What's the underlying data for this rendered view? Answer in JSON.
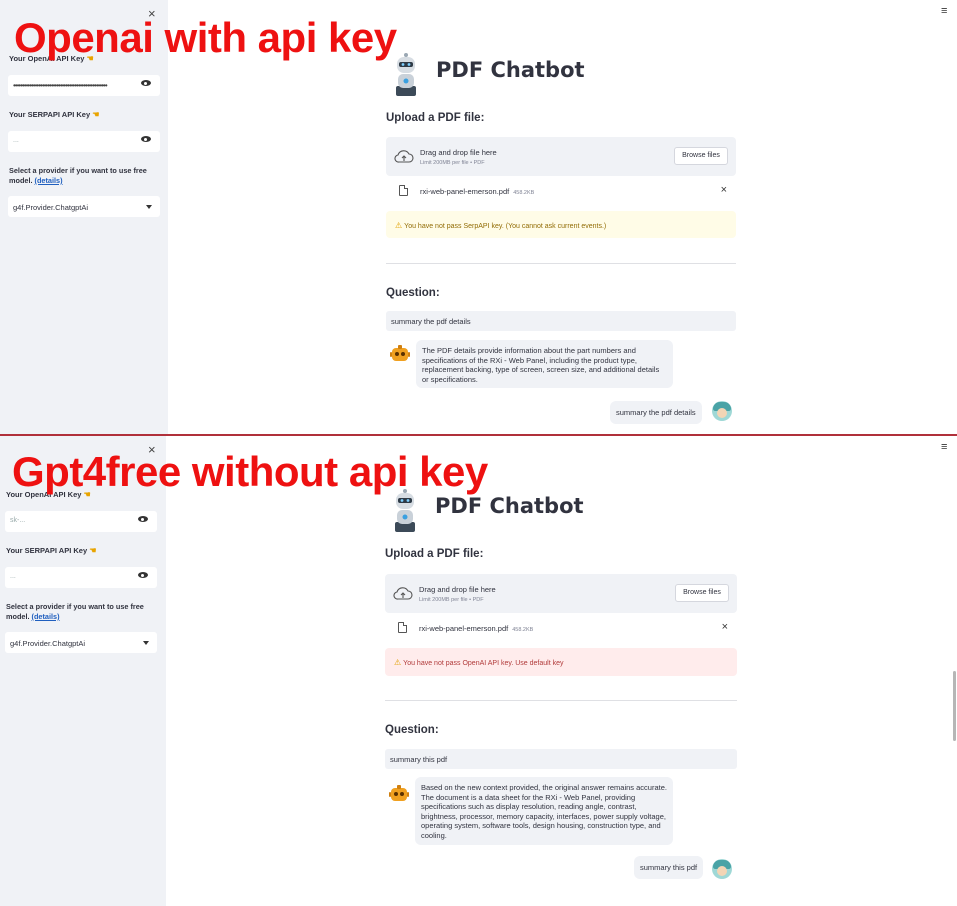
{
  "panels": [
    {
      "overlay_label": "Openai with api key",
      "sidebar": {
        "close": "×",
        "openai_label": "Your OpenAI API Key",
        "openai_value": "••••••••••••••••••••••••••••••••••••••••••••••••••••",
        "serp_label": "Your SERPAPI API Key",
        "serp_value": "...",
        "provider_text": "Select a provider if you want to use free model.",
        "provider_link": "(details)",
        "provider_selected": "g4f.Provider.ChatgptAi"
      },
      "menu": "≡",
      "title": "PDF Chatbot",
      "upload_heading": "Upload a PDF file:",
      "uploader": {
        "drag_text": "Drag and drop file here",
        "limit_text": "Limit 200MB per file • PDF",
        "browse_label": "Browse files"
      },
      "file": {
        "name": "rxi-web-panel-emerson.pdf",
        "size": "458.2KB",
        "remove": "×"
      },
      "alert": {
        "type": "warning",
        "icon": "⚠",
        "text": "You have not pass SerpAPI key. (You cannot ask current events.)"
      },
      "question_heading": "Question:",
      "question_value": "summary the pdf details",
      "bot_answer": "The PDF details provide information about the part numbers and specifications of the RXi - Web Panel, including the product type, replacement backing, type of screen, screen size, and additional details or specifications.",
      "user_message": "summary the pdf details"
    },
    {
      "overlay_label": "Gpt4free without api key",
      "sidebar": {
        "close": "×",
        "openai_label": "Your OpenAI API Key",
        "openai_value": "sk-...",
        "serp_label": "Your SERPAPI API Key",
        "serp_value": "...",
        "provider_text": "Select a provider if you want to use free model.",
        "provider_link": "(details)",
        "provider_selected": "g4f.Provider.ChatgptAi"
      },
      "menu": "≡",
      "title": "PDF Chatbot",
      "upload_heading": "Upload a PDF file:",
      "uploader": {
        "drag_text": "Drag and drop file here",
        "limit_text": "Limit 200MB per file • PDF",
        "browse_label": "Browse files"
      },
      "file": {
        "name": "rxi-web-panel-emerson.pdf",
        "size": "458.2KB",
        "remove": "×"
      },
      "alert": {
        "type": "error",
        "icon": "⚠",
        "text": "You have not pass OpenAI API key. Use default key"
      },
      "question_heading": "Question:",
      "question_value": "summary this pdf",
      "bot_answer": "Based on the new context provided, the original answer remains accurate. The document is a data sheet for the RXi - Web Panel, providing specifications such as display resolution, reading angle, contrast, brightness, processor, memory capacity, interfaces, power supply voltage, operating system, software tools, design housing, construction type, and cooling.",
      "user_message": "summary this pdf"
    }
  ],
  "colors": {
    "overlay": "#ee1111",
    "sidebar_bg": "#f0f2f6",
    "warning_bg": "#fffce7",
    "error_bg": "#ffecec",
    "link": "#1f5fbf"
  },
  "icons": [
    "close-icon",
    "eye-icon",
    "chevron-down-icon",
    "menu-icon",
    "robot-icon",
    "upload-cloud-icon",
    "file-icon",
    "warning-icon",
    "user-avatar-icon"
  ]
}
